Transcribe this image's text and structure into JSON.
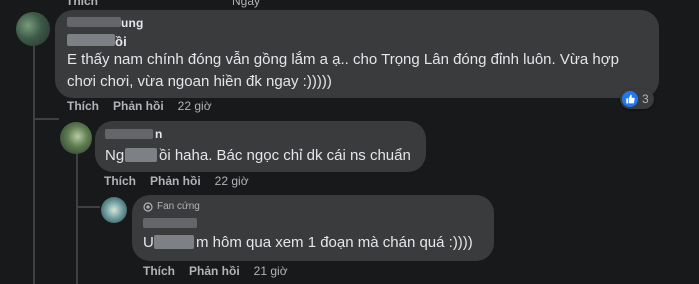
{
  "comments": [
    {
      "id": "c1",
      "text": "E thấy nam chính đóng vẫn gồng lắm a ạ.. cho Trọng Lân đóng đỉnh luôn. Vừa hợp",
      "text_line2": "chơi chơi, vừa ngoan hiền đk ngay :)))))",
      "name_visible": "ung",
      "name_line2_visible": "ồi",
      "like_label": "Thích",
      "reply_label": "Phản hồi",
      "time": "22 giờ",
      "reaction_count": "3",
      "top_like_label": "Thích",
      "top_time": "Ngày"
    },
    {
      "id": "c2",
      "name_visible": "n",
      "text_prefix": "Ng",
      "text": "ồi haha. Bác ngọc chỉ dk cái ns chuẩn",
      "like_label": "Thích",
      "reply_label": "Phản hồi",
      "time": "22 giờ"
    },
    {
      "id": "c3",
      "badge": "Fan cứng",
      "text_prefix": "U",
      "text": "m hôm qua xem 1 đoạn mà chán quá :))))",
      "like_label": "Thích",
      "reply_label": "Phản hồi",
      "time": "21 giờ"
    }
  ],
  "icons": {
    "like": "thumbs-up-icon",
    "fan_badge": "fan-badge-icon"
  },
  "colors": {
    "background": "#18191a",
    "bubble": "#3a3b3c",
    "text": "#e4e6eb",
    "muted": "#b0b3b8",
    "like_blue": "#2078f4"
  }
}
